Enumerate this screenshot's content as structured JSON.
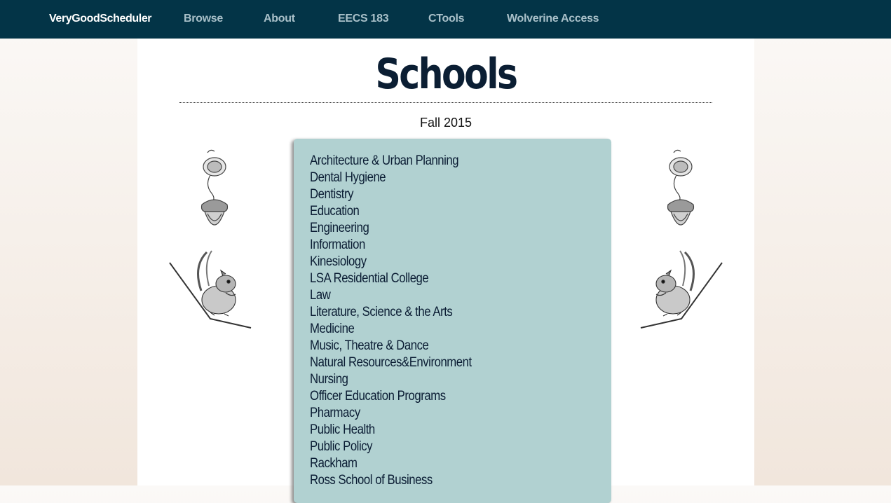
{
  "navbar": {
    "brand": "VeryGoodScheduler",
    "links": [
      "Browse",
      "About",
      "EECS 183",
      "CTools",
      "Wolverine Access"
    ]
  },
  "page": {
    "title": "Schools",
    "term": "Fall 2015"
  },
  "schools": [
    "Architecture & Urban Planning",
    "Dental Hygiene",
    "Dentistry",
    "Education",
    "Engineering",
    "Information",
    "Kinesiology",
    "LSA Residential College",
    "Law",
    "Literature, Science & the Arts",
    "Medicine",
    "Music, Theatre & Dance",
    "Natural Resources&Environment",
    "Nursing",
    "Officer Education Programs",
    "Pharmacy",
    "Public Health",
    "Public Policy",
    "Rackham",
    "Ross School of Business"
  ],
  "decorations": {
    "left": [
      "acorn-icon",
      "squirrel-icon"
    ],
    "right": [
      "acorn-icon",
      "squirrel-icon"
    ]
  },
  "colors": {
    "navbar": "#033447",
    "panel": "#b1d1d1",
    "title": "#0b1e33"
  }
}
